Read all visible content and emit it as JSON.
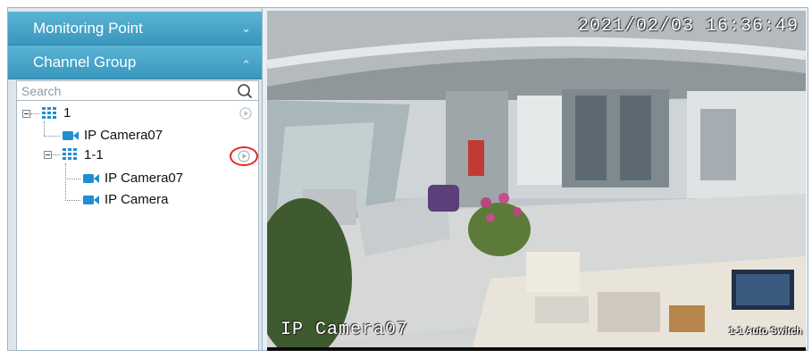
{
  "accordion": {
    "monitoring_point": "Monitoring Point",
    "channel_group": "Channel Group"
  },
  "search": {
    "placeholder": "Search"
  },
  "tree": {
    "group1": {
      "label": "1",
      "children_label": "IP Camera07"
    },
    "group11": {
      "label": "1-1"
    },
    "cam_a": "IP Camera07",
    "cam_b": "IP Camera"
  },
  "video": {
    "timestamp": "2021/02/03  16:36:49",
    "camera_name": "IP Camera07",
    "auto_switch": "1-1 Auto Switch"
  },
  "colors": {
    "accent": "#3a96bd",
    "highlight": "#e0282a",
    "camera_icon": "#1e8fd0"
  },
  "icons": [
    "chevron-down-icon",
    "chevron-up-icon",
    "search-icon",
    "group-grid-icon",
    "camera-icon",
    "auto-switch-icon"
  ]
}
